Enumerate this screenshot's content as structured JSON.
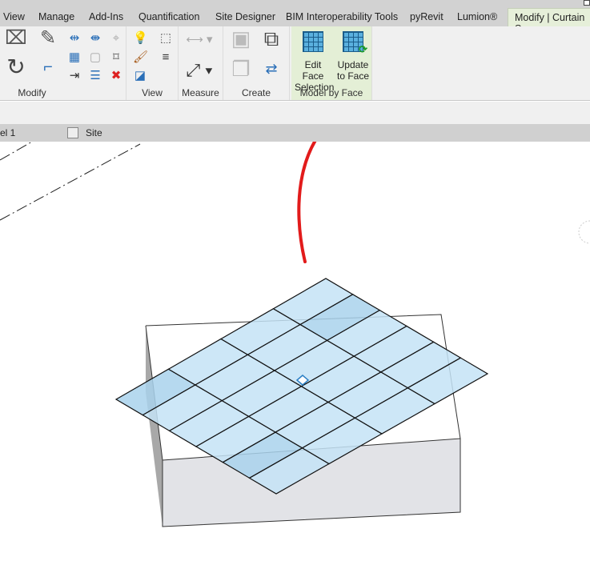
{
  "tabs": [
    {
      "label": "View"
    },
    {
      "label": "Manage"
    },
    {
      "label": "Add-Ins"
    },
    {
      "label": "Quantification"
    },
    {
      "label": "Site Designer"
    },
    {
      "label": "BIM Interoperability Tools"
    },
    {
      "label": "pyRevit"
    },
    {
      "label": "Lumion®"
    },
    {
      "label": "Modify | Curtain S",
      "active": true
    }
  ],
  "ribbon": {
    "panels": {
      "modify": "Modify",
      "view": "View",
      "measure": "Measure",
      "create": "Create",
      "model_by_face": "Model by Face"
    },
    "edit_face_selection": {
      "line1": "Edit Face",
      "line2": "Selection"
    },
    "update_to_face": {
      "line1": "Update",
      "line2": "to Face"
    }
  },
  "view_tabs": {
    "level": "el 1",
    "site": "Site"
  },
  "colors": {
    "accent_tab": "#e6efd9",
    "annotation": "#e21b1b",
    "panel_fill": "#bfe0f5"
  }
}
